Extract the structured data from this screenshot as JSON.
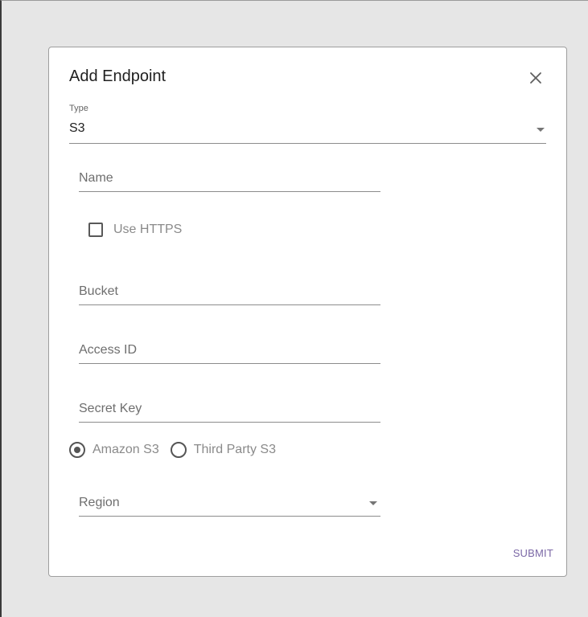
{
  "dialog": {
    "title": "Add Endpoint",
    "close_icon": "close-icon"
  },
  "type": {
    "label": "Type",
    "value": "S3"
  },
  "fields": {
    "name_placeholder": "Name",
    "bucket_placeholder": "Bucket",
    "access_id_placeholder": "Access ID",
    "secret_key_placeholder": "Secret Key"
  },
  "use_https": {
    "label": "Use HTTPS",
    "checked": false
  },
  "provider": {
    "options": [
      {
        "label": "Amazon S3",
        "selected": true
      },
      {
        "label": "Third Party S3",
        "selected": false
      }
    ]
  },
  "region": {
    "placeholder": "Region"
  },
  "actions": {
    "submit_label": "SUBMIT"
  },
  "colors": {
    "accent": "#7b68a6",
    "backdrop": "#e6e6e6"
  }
}
